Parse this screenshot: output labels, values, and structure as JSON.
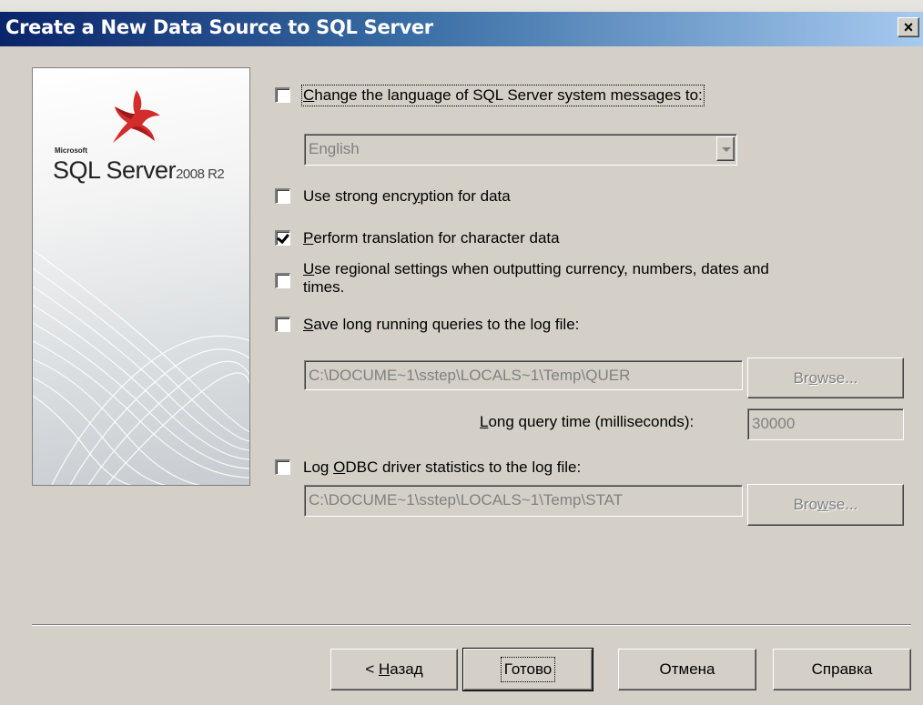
{
  "window": {
    "title": "Create a New Data Source to SQL Server",
    "close_label": "×"
  },
  "logo": {
    "brand_small": "Microsoft",
    "product": "SQL Server",
    "version": "2008 R2",
    "accent_color": "#d42b2b"
  },
  "options": {
    "change_language": {
      "checked": false,
      "pre": "",
      "accel": "C",
      "post": "hange the language of SQL Server system messages to:"
    },
    "language_select": {
      "value": "English",
      "enabled": false
    },
    "strong_encryption": {
      "checked": false,
      "pre": "Use strong encr",
      "accel": "y",
      "post": "ption for data"
    },
    "translate_char": {
      "checked": true,
      "pre": "",
      "accel": "P",
      "post": "erform translation for character data"
    },
    "regional_settings": {
      "checked": false,
      "line1_pre": "",
      "accel": "U",
      "line1_post": "se regional settings when outputting currency, numbers, dates and",
      "line2": "times."
    },
    "save_long_queries": {
      "checked": false,
      "pre": "",
      "accel": "S",
      "post": "ave long running queries to the log file:"
    },
    "query_log_path": "C:\\DOCUME~1\\sstep\\LOCALS~1\\Temp\\QUER",
    "browse1": {
      "pre": "Br",
      "accel": "o",
      "post": "wse..."
    },
    "long_query_time": {
      "pre": "",
      "accel": "L",
      "post": "ong query time (milliseconds):",
      "value": "30000"
    },
    "log_odbc_stats": {
      "checked": false,
      "pre": "Log ",
      "accel": "O",
      "post": "DBC driver statistics to the log file:"
    },
    "stats_log_path": "C:\\DOCUME~1\\sstep\\LOCALS~1\\Temp\\STAT",
    "browse2": {
      "pre": "Bro",
      "accel": "w",
      "post": "se..."
    }
  },
  "buttons": {
    "back": {
      "pre": "< ",
      "accel": "Н",
      "post": "азад"
    },
    "finish": "Готово",
    "cancel": "Отмена",
    "help": "Справка"
  }
}
